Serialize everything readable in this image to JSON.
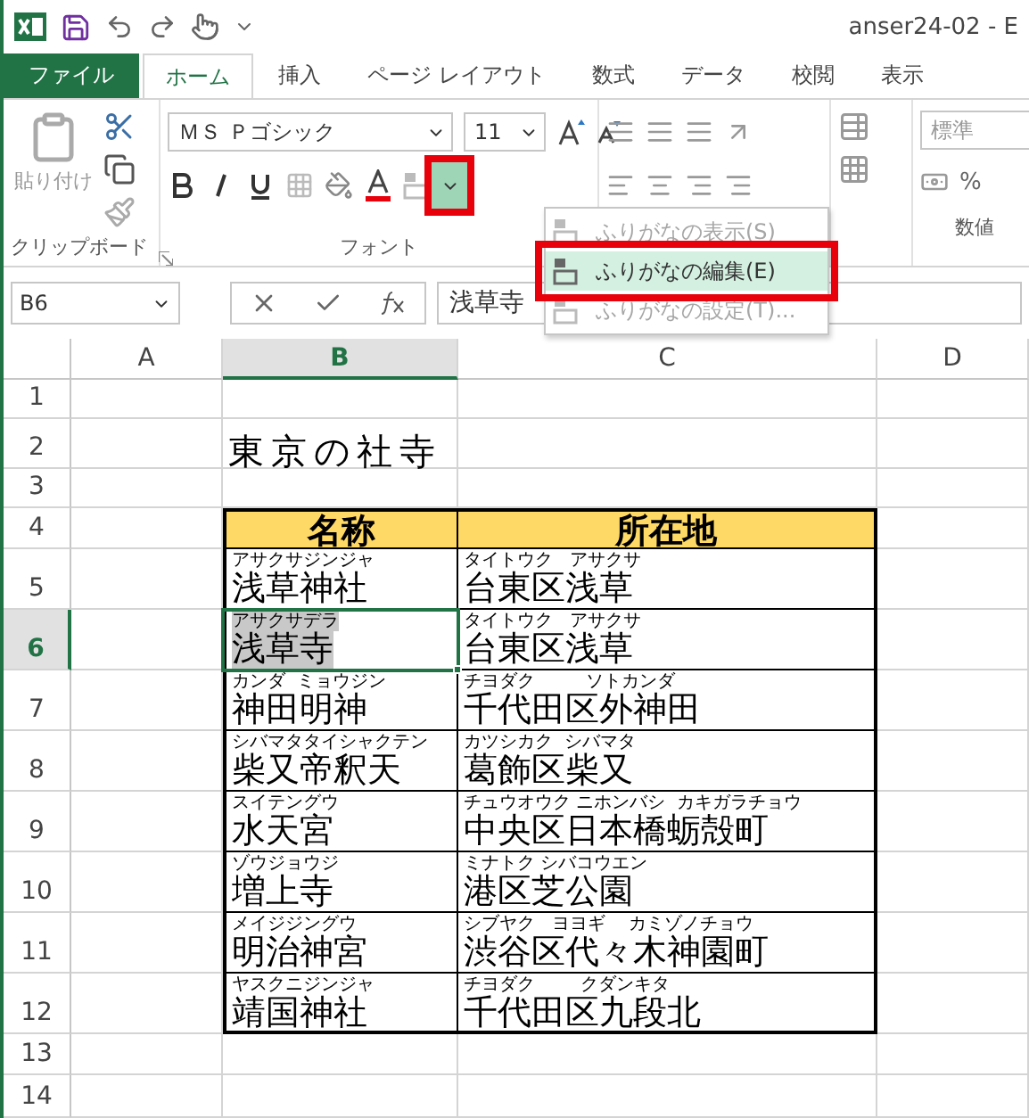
{
  "title_bar": {
    "title": "anser24-02 - E"
  },
  "tabs": [
    {
      "label": "ファイル",
      "kind": "file",
      "selected": false
    },
    {
      "label": "ホーム",
      "kind": "tab",
      "selected": true
    },
    {
      "label": "挿入",
      "kind": "tab",
      "selected": false
    },
    {
      "label": "ページ レイアウト",
      "kind": "tab",
      "selected": false
    },
    {
      "label": "数式",
      "kind": "tab",
      "selected": false
    },
    {
      "label": "データ",
      "kind": "tab",
      "selected": false
    },
    {
      "label": "校閲",
      "kind": "tab",
      "selected": false
    },
    {
      "label": "表示",
      "kind": "tab",
      "selected": false
    }
  ],
  "ribbon": {
    "clipboard": {
      "paste_label": "貼り付け",
      "group_label": "クリップボード"
    },
    "font": {
      "font_name": "ＭＳ Ｐゴシック",
      "font_size": "11",
      "group_label": "フォント",
      "furigana_highlighted": true
    },
    "number": {
      "format": "標準",
      "percent": "%",
      "group_label": "数値"
    }
  },
  "furigana_menu": {
    "items": [
      {
        "label": "ふりがなの表示(S)",
        "disabled": true,
        "selected": false,
        "highlighted": false
      },
      {
        "label": "ふりがなの編集(E)",
        "disabled": false,
        "selected": true,
        "highlighted": true
      },
      {
        "label": "ふりがなの設定(T)...",
        "disabled": true,
        "selected": false,
        "highlighted": false
      }
    ]
  },
  "formula_bar": {
    "name_box": "B6",
    "formula": "浅草寺"
  },
  "sheet": {
    "columns": [
      {
        "label": "A",
        "selected": false
      },
      {
        "label": "B",
        "selected": true
      },
      {
        "label": "C",
        "selected": false
      },
      {
        "label": "D",
        "selected": false
      }
    ],
    "rows": [
      {
        "label": "1",
        "selected": false
      },
      {
        "label": "2",
        "selected": false
      },
      {
        "label": "3",
        "selected": false
      },
      {
        "label": "4",
        "selected": false
      },
      {
        "label": "5",
        "selected": false
      },
      {
        "label": "6",
        "selected": true
      },
      {
        "label": "7",
        "selected": false
      },
      {
        "label": "8",
        "selected": false
      },
      {
        "label": "9",
        "selected": false
      },
      {
        "label": "10",
        "selected": false
      },
      {
        "label": "11",
        "selected": false
      },
      {
        "label": "12",
        "selected": false
      },
      {
        "label": "13",
        "selected": false
      },
      {
        "label": "14",
        "selected": false
      }
    ],
    "title": "東京の社寺",
    "table": {
      "headers": [
        "名称",
        "所在地"
      ],
      "rows": [
        {
          "selected": false,
          "name": {
            "ruby": "アサクサジンジャ",
            "text": "浅草神社"
          },
          "location": {
            "ruby": "タイトウク   アサクサ",
            "text": "台東区浅草"
          }
        },
        {
          "selected": true,
          "name": {
            "ruby": "アサクサデラ",
            "text": "浅草寺"
          },
          "location": {
            "ruby": "タイトウク   アサクサ",
            "text": "台東区浅草"
          }
        },
        {
          "selected": false,
          "name": {
            "ruby": "カンダ  ミョウジン",
            "text": "神田明神"
          },
          "location": {
            "ruby": "チヨダク         ソトカンダ",
            "text": "千代田区外神田"
          }
        },
        {
          "selected": false,
          "name": {
            "ruby": "シバマタタイシャクテン",
            "text": "柴又帝釈天"
          },
          "location": {
            "ruby": "カツシカク  シバマタ",
            "text": "葛飾区柴又"
          }
        },
        {
          "selected": false,
          "name": {
            "ruby": "スイテングウ",
            "text": "水天宮"
          },
          "location": {
            "ruby": "チュウオウク ニホンバシ  カキガラチョウ",
            "text": "中央区日本橋蛎殻町"
          }
        },
        {
          "selected": false,
          "name": {
            "ruby": "ゾウジョウジ",
            "text": "増上寺"
          },
          "location": {
            "ruby": "ミナトク シバコウエン",
            "text": "港区芝公園"
          }
        },
        {
          "selected": false,
          "name": {
            "ruby": "メイジジングウ",
            "text": "明治神宮"
          },
          "location": {
            "ruby": "シブヤク   ヨヨギ    カミゾノチョウ",
            "text": "渋谷区代々木神園町"
          }
        },
        {
          "selected": false,
          "name": {
            "ruby": "ヤスクニジンジャ",
            "text": "靖国神社"
          },
          "location": {
            "ruby": "チヨダク        クダンキタ",
            "text": "千代田区九段北"
          }
        }
      ]
    }
  }
}
